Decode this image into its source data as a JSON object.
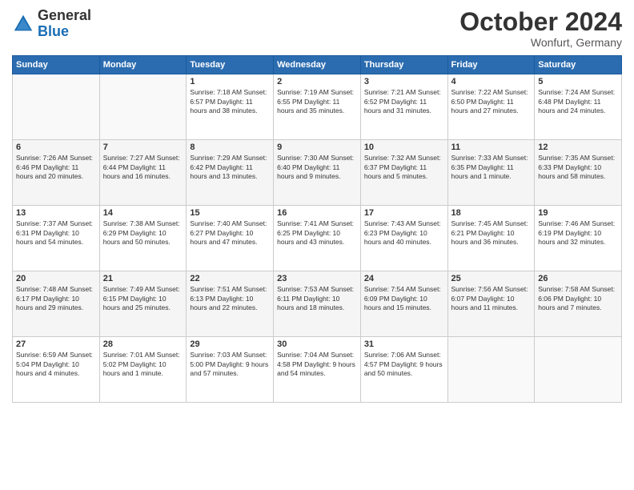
{
  "header": {
    "logo_general": "General",
    "logo_blue": "Blue",
    "month_title": "October 2024",
    "location": "Wonfurt, Germany"
  },
  "days_of_week": [
    "Sunday",
    "Monday",
    "Tuesday",
    "Wednesday",
    "Thursday",
    "Friday",
    "Saturday"
  ],
  "weeks": [
    [
      {
        "day": "",
        "info": ""
      },
      {
        "day": "",
        "info": ""
      },
      {
        "day": "1",
        "info": "Sunrise: 7:18 AM\nSunset: 6:57 PM\nDaylight: 11 hours and 38 minutes."
      },
      {
        "day": "2",
        "info": "Sunrise: 7:19 AM\nSunset: 6:55 PM\nDaylight: 11 hours and 35 minutes."
      },
      {
        "day": "3",
        "info": "Sunrise: 7:21 AM\nSunset: 6:52 PM\nDaylight: 11 hours and 31 minutes."
      },
      {
        "day": "4",
        "info": "Sunrise: 7:22 AM\nSunset: 6:50 PM\nDaylight: 11 hours and 27 minutes."
      },
      {
        "day": "5",
        "info": "Sunrise: 7:24 AM\nSunset: 6:48 PM\nDaylight: 11 hours and 24 minutes."
      }
    ],
    [
      {
        "day": "6",
        "info": "Sunrise: 7:26 AM\nSunset: 6:46 PM\nDaylight: 11 hours and 20 minutes."
      },
      {
        "day": "7",
        "info": "Sunrise: 7:27 AM\nSunset: 6:44 PM\nDaylight: 11 hours and 16 minutes."
      },
      {
        "day": "8",
        "info": "Sunrise: 7:29 AM\nSunset: 6:42 PM\nDaylight: 11 hours and 13 minutes."
      },
      {
        "day": "9",
        "info": "Sunrise: 7:30 AM\nSunset: 6:40 PM\nDaylight: 11 hours and 9 minutes."
      },
      {
        "day": "10",
        "info": "Sunrise: 7:32 AM\nSunset: 6:37 PM\nDaylight: 11 hours and 5 minutes."
      },
      {
        "day": "11",
        "info": "Sunrise: 7:33 AM\nSunset: 6:35 PM\nDaylight: 11 hours and 1 minute."
      },
      {
        "day": "12",
        "info": "Sunrise: 7:35 AM\nSunset: 6:33 PM\nDaylight: 10 hours and 58 minutes."
      }
    ],
    [
      {
        "day": "13",
        "info": "Sunrise: 7:37 AM\nSunset: 6:31 PM\nDaylight: 10 hours and 54 minutes."
      },
      {
        "day": "14",
        "info": "Sunrise: 7:38 AM\nSunset: 6:29 PM\nDaylight: 10 hours and 50 minutes."
      },
      {
        "day": "15",
        "info": "Sunrise: 7:40 AM\nSunset: 6:27 PM\nDaylight: 10 hours and 47 minutes."
      },
      {
        "day": "16",
        "info": "Sunrise: 7:41 AM\nSunset: 6:25 PM\nDaylight: 10 hours and 43 minutes."
      },
      {
        "day": "17",
        "info": "Sunrise: 7:43 AM\nSunset: 6:23 PM\nDaylight: 10 hours and 40 minutes."
      },
      {
        "day": "18",
        "info": "Sunrise: 7:45 AM\nSunset: 6:21 PM\nDaylight: 10 hours and 36 minutes."
      },
      {
        "day": "19",
        "info": "Sunrise: 7:46 AM\nSunset: 6:19 PM\nDaylight: 10 hours and 32 minutes."
      }
    ],
    [
      {
        "day": "20",
        "info": "Sunrise: 7:48 AM\nSunset: 6:17 PM\nDaylight: 10 hours and 29 minutes."
      },
      {
        "day": "21",
        "info": "Sunrise: 7:49 AM\nSunset: 6:15 PM\nDaylight: 10 hours and 25 minutes."
      },
      {
        "day": "22",
        "info": "Sunrise: 7:51 AM\nSunset: 6:13 PM\nDaylight: 10 hours and 22 minutes."
      },
      {
        "day": "23",
        "info": "Sunrise: 7:53 AM\nSunset: 6:11 PM\nDaylight: 10 hours and 18 minutes."
      },
      {
        "day": "24",
        "info": "Sunrise: 7:54 AM\nSunset: 6:09 PM\nDaylight: 10 hours and 15 minutes."
      },
      {
        "day": "25",
        "info": "Sunrise: 7:56 AM\nSunset: 6:07 PM\nDaylight: 10 hours and 11 minutes."
      },
      {
        "day": "26",
        "info": "Sunrise: 7:58 AM\nSunset: 6:06 PM\nDaylight: 10 hours and 7 minutes."
      }
    ],
    [
      {
        "day": "27",
        "info": "Sunrise: 6:59 AM\nSunset: 5:04 PM\nDaylight: 10 hours and 4 minutes."
      },
      {
        "day": "28",
        "info": "Sunrise: 7:01 AM\nSunset: 5:02 PM\nDaylight: 10 hours and 1 minute."
      },
      {
        "day": "29",
        "info": "Sunrise: 7:03 AM\nSunset: 5:00 PM\nDaylight: 9 hours and 57 minutes."
      },
      {
        "day": "30",
        "info": "Sunrise: 7:04 AM\nSunset: 4:58 PM\nDaylight: 9 hours and 54 minutes."
      },
      {
        "day": "31",
        "info": "Sunrise: 7:06 AM\nSunset: 4:57 PM\nDaylight: 9 hours and 50 minutes."
      },
      {
        "day": "",
        "info": ""
      },
      {
        "day": "",
        "info": ""
      }
    ]
  ]
}
